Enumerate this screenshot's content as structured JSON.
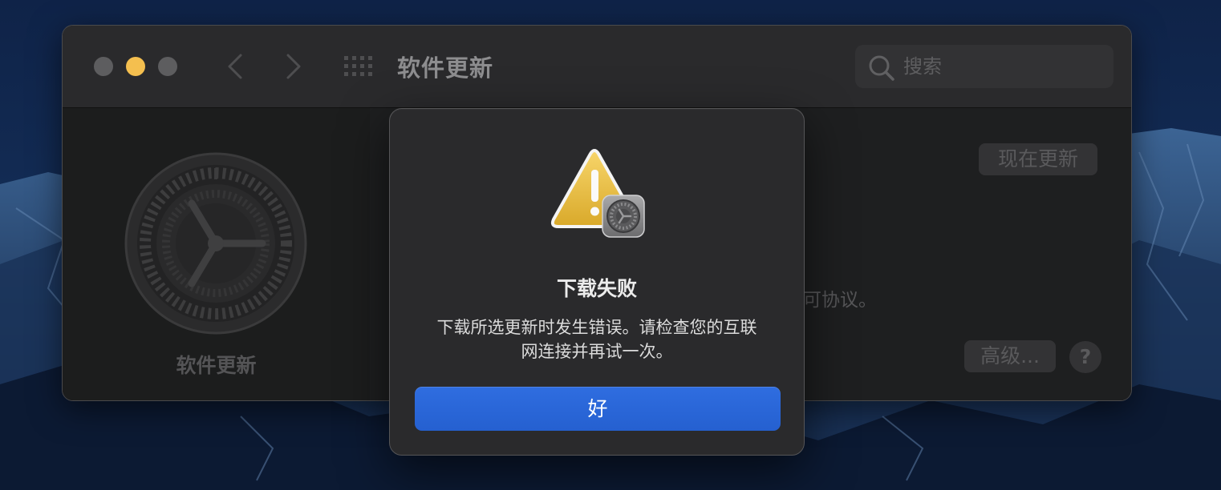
{
  "window": {
    "title": "软件更新",
    "search_placeholder": "搜索"
  },
  "pane": {
    "icon_label": "软件更新",
    "update_now_label": "现在更新",
    "partial_text": "可协议。",
    "advanced_label": "高级...",
    "help_label": "?"
  },
  "dialog": {
    "title": "下载失败",
    "message_line1": "下载所选更新时发生错误。请检查您的互联",
    "message_line2": "网连接并再试一次。",
    "ok_label": "好"
  },
  "colors": {
    "accent_button": "#2a65d8",
    "minimize_light": "#f4bf4f",
    "warning_yellow": "#f2c94c"
  },
  "icons": [
    "close-traffic-light",
    "minimize-traffic-light",
    "zoom-traffic-light",
    "chevron-left-icon",
    "chevron-right-icon",
    "grid-icon",
    "search-icon",
    "gear-icon",
    "warning-icon"
  ]
}
